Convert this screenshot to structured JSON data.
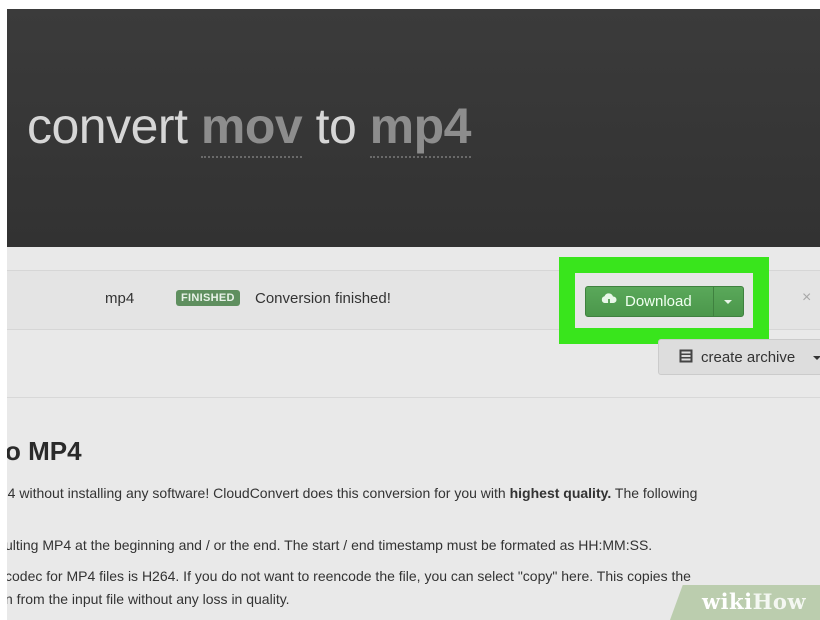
{
  "hero": {
    "title_part1": "convert ",
    "source_format": "mov",
    "title_part2": " to ",
    "target_format": "mp4"
  },
  "conversion": {
    "format": "mp4",
    "badge": "FINISHED",
    "status": "Conversion finished!",
    "download_label": "Download",
    "close_symbol": "×",
    "highlight_color": "#39e51c",
    "button_color": "#4f9e4f"
  },
  "archive": {
    "label": "create archive"
  },
  "content": {
    "heading": "o MP4",
    "line1_pre": "'4 without installing any software! CloudConvert does this conversion for you with ",
    "line1_bold": "highest quality.",
    "line1_post": " The following",
    "line2": "ulting MP4 at the beginning and / or the end. The start / end timestamp must be formated as HH:MM:SS.",
    "line3": " codec for MP4 files is H264. If you do not want to reencode the file, you can select \"copy\" here. This copies the",
    "line4": "n from the input file without any loss in quality."
  },
  "watermark": {
    "part1": "wiki",
    "part2": "How"
  },
  "icons": [
    "cloud-download-icon",
    "chevron-down-icon",
    "close-icon",
    "archive-icon"
  ]
}
